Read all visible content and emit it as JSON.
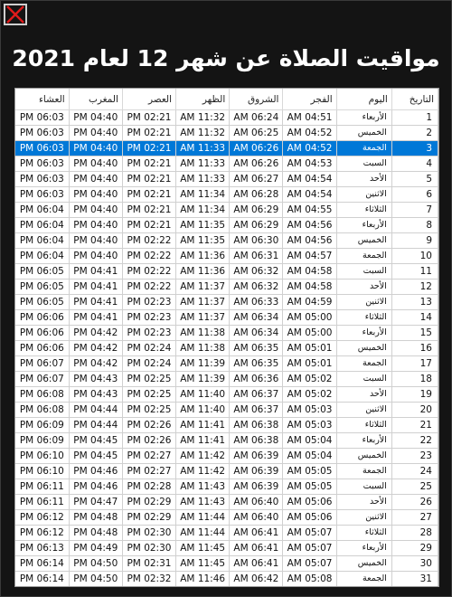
{
  "window": {
    "title": "مواقيت الصلاة عن شهر 12 لعام 2021",
    "close_icon": "close-icon"
  },
  "colors": {
    "background": "#141414",
    "selected_row": "#0078d7",
    "close_x": "#e01b1b"
  },
  "table": {
    "headers": {
      "isha": "العشاء",
      "maghrib": "المغرب",
      "asr": "العصر",
      "dhuhr": "الظهر",
      "sunrise": "الشروق",
      "fajr": "الفجر",
      "day": "اليوم",
      "date": "التاريخ"
    },
    "selected_index": 2,
    "rows": [
      {
        "isha": "PM 06:03",
        "maghrib": "PM 04:40",
        "asr": "PM 02:21",
        "dhuhr": "AM 11:32",
        "sunrise": "AM 06:24",
        "fajr": "AM 04:51",
        "day": "الأربعاء",
        "date": "1"
      },
      {
        "isha": "PM 06:03",
        "maghrib": "PM 04:40",
        "asr": "PM 02:21",
        "dhuhr": "AM 11:32",
        "sunrise": "AM 06:25",
        "fajr": "AM 04:52",
        "day": "الخميس",
        "date": "2"
      },
      {
        "isha": "PM 06:03",
        "maghrib": "PM 04:40",
        "asr": "PM 02:21",
        "dhuhr": "AM 11:33",
        "sunrise": "AM 06:26",
        "fajr": "AM 04:52",
        "day": "الجمعة",
        "date": "3"
      },
      {
        "isha": "PM 06:03",
        "maghrib": "PM 04:40",
        "asr": "PM 02:21",
        "dhuhr": "AM 11:33",
        "sunrise": "AM 06:26",
        "fajr": "AM 04:53",
        "day": "السبت",
        "date": "4"
      },
      {
        "isha": "PM 06:03",
        "maghrib": "PM 04:40",
        "asr": "PM 02:21",
        "dhuhr": "AM 11:33",
        "sunrise": "AM 06:27",
        "fajr": "AM 04:54",
        "day": "الأحد",
        "date": "5"
      },
      {
        "isha": "PM 06:03",
        "maghrib": "PM 04:40",
        "asr": "PM 02:21",
        "dhuhr": "AM 11:34",
        "sunrise": "AM 06:28",
        "fajr": "AM 04:54",
        "day": "الاثنين",
        "date": "6"
      },
      {
        "isha": "PM 06:04",
        "maghrib": "PM 04:40",
        "asr": "PM 02:21",
        "dhuhr": "AM 11:34",
        "sunrise": "AM 06:29",
        "fajr": "AM 04:55",
        "day": "الثلاثاء",
        "date": "7"
      },
      {
        "isha": "PM 06:04",
        "maghrib": "PM 04:40",
        "asr": "PM 02:21",
        "dhuhr": "AM 11:35",
        "sunrise": "AM 06:29",
        "fajr": "AM 04:56",
        "day": "الأربعاء",
        "date": "8"
      },
      {
        "isha": "PM 06:04",
        "maghrib": "PM 04:40",
        "asr": "PM 02:22",
        "dhuhr": "AM 11:35",
        "sunrise": "AM 06:30",
        "fajr": "AM 04:56",
        "day": "الخميس",
        "date": "9"
      },
      {
        "isha": "PM 06:04",
        "maghrib": "PM 04:40",
        "asr": "PM 02:22",
        "dhuhr": "AM 11:36",
        "sunrise": "AM 06:31",
        "fajr": "AM 04:57",
        "day": "الجمعة",
        "date": "10"
      },
      {
        "isha": "PM 06:05",
        "maghrib": "PM 04:41",
        "asr": "PM 02:22",
        "dhuhr": "AM 11:36",
        "sunrise": "AM 06:32",
        "fajr": "AM 04:58",
        "day": "السبت",
        "date": "11"
      },
      {
        "isha": "PM 06:05",
        "maghrib": "PM 04:41",
        "asr": "PM 02:22",
        "dhuhr": "AM 11:37",
        "sunrise": "AM 06:32",
        "fajr": "AM 04:58",
        "day": "الأحد",
        "date": "12"
      },
      {
        "isha": "PM 06:05",
        "maghrib": "PM 04:41",
        "asr": "PM 02:23",
        "dhuhr": "AM 11:37",
        "sunrise": "AM 06:33",
        "fajr": "AM 04:59",
        "day": "الاثنين",
        "date": "13"
      },
      {
        "isha": "PM 06:06",
        "maghrib": "PM 04:41",
        "asr": "PM 02:23",
        "dhuhr": "AM 11:37",
        "sunrise": "AM 06:34",
        "fajr": "AM 05:00",
        "day": "الثلاثاء",
        "date": "14"
      },
      {
        "isha": "PM 06:06",
        "maghrib": "PM 04:42",
        "asr": "PM 02:23",
        "dhuhr": "AM 11:38",
        "sunrise": "AM 06:34",
        "fajr": "AM 05:00",
        "day": "الأربعاء",
        "date": "15"
      },
      {
        "isha": "PM 06:06",
        "maghrib": "PM 04:42",
        "asr": "PM 02:24",
        "dhuhr": "AM 11:38",
        "sunrise": "AM 06:35",
        "fajr": "AM 05:01",
        "day": "الخميس",
        "date": "16"
      },
      {
        "isha": "PM 06:07",
        "maghrib": "PM 04:42",
        "asr": "PM 02:24",
        "dhuhr": "AM 11:39",
        "sunrise": "AM 06:35",
        "fajr": "AM 05:01",
        "day": "الجمعة",
        "date": "17"
      },
      {
        "isha": "PM 06:07",
        "maghrib": "PM 04:43",
        "asr": "PM 02:25",
        "dhuhr": "AM 11:39",
        "sunrise": "AM 06:36",
        "fajr": "AM 05:02",
        "day": "السبت",
        "date": "18"
      },
      {
        "isha": "PM 06:08",
        "maghrib": "PM 04:43",
        "asr": "PM 02:25",
        "dhuhr": "AM 11:40",
        "sunrise": "AM 06:37",
        "fajr": "AM 05:02",
        "day": "الأحد",
        "date": "19"
      },
      {
        "isha": "PM 06:08",
        "maghrib": "PM 04:44",
        "asr": "PM 02:25",
        "dhuhr": "AM 11:40",
        "sunrise": "AM 06:37",
        "fajr": "AM 05:03",
        "day": "الاثنين",
        "date": "20"
      },
      {
        "isha": "PM 06:09",
        "maghrib": "PM 04:44",
        "asr": "PM 02:26",
        "dhuhr": "AM 11:41",
        "sunrise": "AM 06:38",
        "fajr": "AM 05:03",
        "day": "الثلاثاء",
        "date": "21"
      },
      {
        "isha": "PM 06:09",
        "maghrib": "PM 04:45",
        "asr": "PM 02:26",
        "dhuhr": "AM 11:41",
        "sunrise": "AM 06:38",
        "fajr": "AM 05:04",
        "day": "الأربعاء",
        "date": "22"
      },
      {
        "isha": "PM 06:10",
        "maghrib": "PM 04:45",
        "asr": "PM 02:27",
        "dhuhr": "AM 11:42",
        "sunrise": "AM 06:39",
        "fajr": "AM 05:04",
        "day": "الخميس",
        "date": "23"
      },
      {
        "isha": "PM 06:10",
        "maghrib": "PM 04:46",
        "asr": "PM 02:27",
        "dhuhr": "AM 11:42",
        "sunrise": "AM 06:39",
        "fajr": "AM 05:05",
        "day": "الجمعة",
        "date": "24"
      },
      {
        "isha": "PM 06:11",
        "maghrib": "PM 04:46",
        "asr": "PM 02:28",
        "dhuhr": "AM 11:43",
        "sunrise": "AM 06:39",
        "fajr": "AM 05:05",
        "day": "السبت",
        "date": "25"
      },
      {
        "isha": "PM 06:11",
        "maghrib": "PM 04:47",
        "asr": "PM 02:29",
        "dhuhr": "AM 11:43",
        "sunrise": "AM 06:40",
        "fajr": "AM 05:06",
        "day": "الأحد",
        "date": "26"
      },
      {
        "isha": "PM 06:12",
        "maghrib": "PM 04:48",
        "asr": "PM 02:29",
        "dhuhr": "AM 11:44",
        "sunrise": "AM 06:40",
        "fajr": "AM 05:06",
        "day": "الاثنين",
        "date": "27"
      },
      {
        "isha": "PM 06:12",
        "maghrib": "PM 04:48",
        "asr": "PM 02:30",
        "dhuhr": "AM 11:44",
        "sunrise": "AM 06:41",
        "fajr": "AM 05:07",
        "day": "الثلاثاء",
        "date": "28"
      },
      {
        "isha": "PM 06:13",
        "maghrib": "PM 04:49",
        "asr": "PM 02:30",
        "dhuhr": "AM 11:45",
        "sunrise": "AM 06:41",
        "fajr": "AM 05:07",
        "day": "الأربعاء",
        "date": "29"
      },
      {
        "isha": "PM 06:14",
        "maghrib": "PM 04:50",
        "asr": "PM 02:31",
        "dhuhr": "AM 11:45",
        "sunrise": "AM 06:41",
        "fajr": "AM 05:07",
        "day": "الخميس",
        "date": "30"
      },
      {
        "isha": "PM 06:14",
        "maghrib": "PM 04:50",
        "asr": "PM 02:32",
        "dhuhr": "AM 11:46",
        "sunrise": "AM 06:42",
        "fajr": "AM 05:08",
        "day": "الجمعة",
        "date": "31"
      }
    ]
  }
}
